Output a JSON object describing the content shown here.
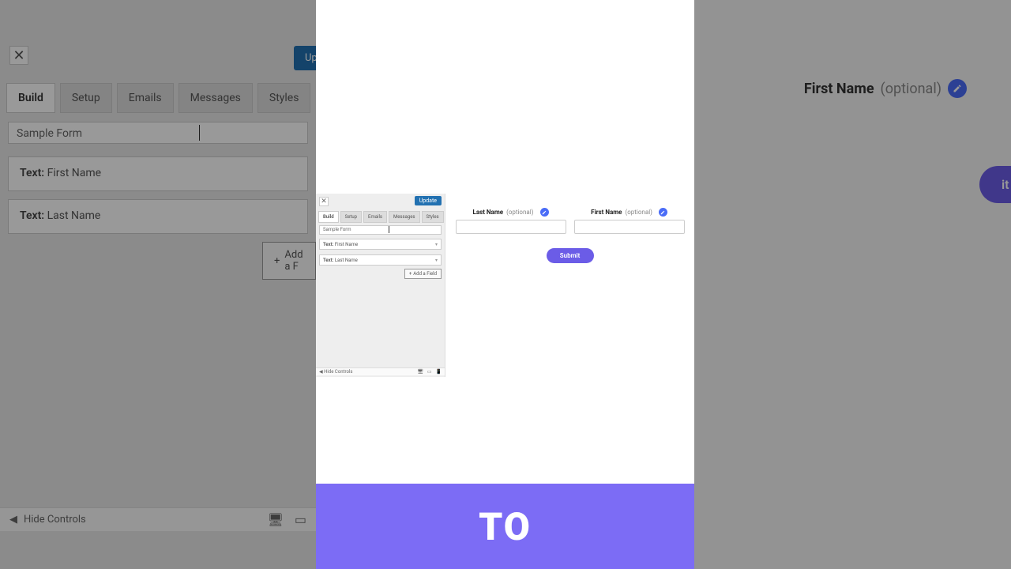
{
  "background": {
    "close_label": "✕",
    "update_label": "Upd",
    "tabs": [
      "Build",
      "Setup",
      "Emails",
      "Messages",
      "Styles"
    ],
    "form_title": "Sample Form",
    "field1_prefix": "Text:",
    "field1_label": "First Name",
    "field2_prefix": "Text:",
    "field2_label": "Last Name",
    "add_field_label": "Add a F",
    "hide_controls": "Hide Controls",
    "preview_field_name": "First Name",
    "preview_optional": "(optional)",
    "submit_label": "it"
  },
  "mini": {
    "close_label": "✕",
    "update_label": "Update",
    "tabs": [
      "Build",
      "Setup",
      "Emails",
      "Messages",
      "Styles"
    ],
    "form_title": "Sample Form",
    "field1_prefix": "Text:",
    "field1_label": "First Name",
    "field2_prefix": "Text:",
    "field2_label": "Last Name",
    "add_field_label": "Add a Field",
    "hide_controls": "Hide Controls",
    "preview": {
      "field1_name": "Last Name",
      "field1_opt": "(optional)",
      "field2_name": "First Name",
      "field2_opt": "(optional)",
      "submit": "Submit"
    }
  },
  "caption": "TO",
  "icons": {
    "plus": "+",
    "desktop": "🖥",
    "tablet": "▭",
    "mobile": "📱",
    "collapse": "◀"
  }
}
